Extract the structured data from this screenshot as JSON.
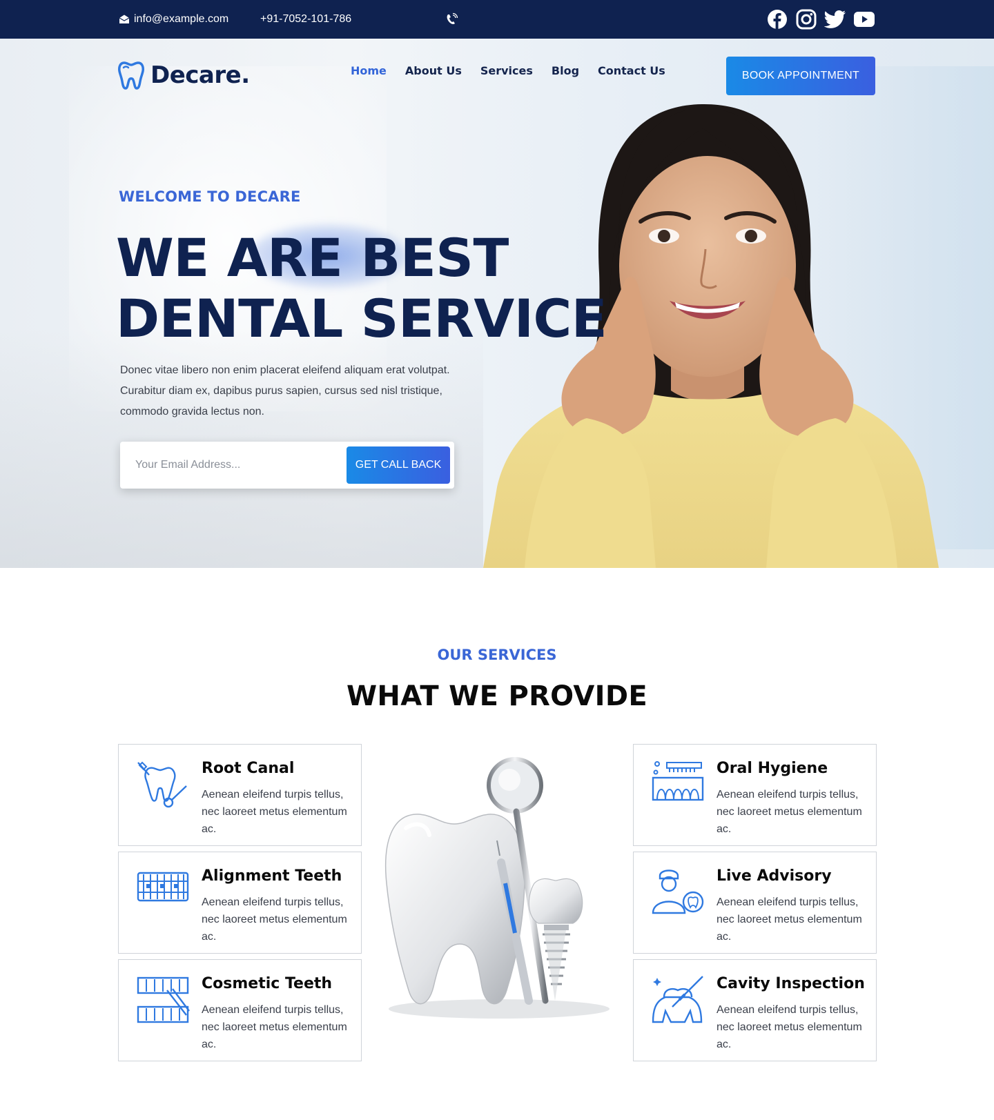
{
  "topbar": {
    "email": "info@example.com",
    "phone": "+91-7052-101-786",
    "socials": [
      "facebook-icon",
      "instagram-icon",
      "twitter-icon",
      "youtube-icon"
    ]
  },
  "nav": {
    "logo": "Decare.",
    "items": [
      "Home",
      "About Us",
      "Services",
      "Blog",
      "Contact Us"
    ],
    "active": "Home",
    "cta": "BOOK APPOINTMENT"
  },
  "hero": {
    "kicker": "WELCOME TO DECARE",
    "title_line1": "WE ARE BEST",
    "title_line2": "DENTAL SERVICE",
    "description": "Donec vitae libero non enim placerat eleifend aliquam erat volutpat. Curabitur diam ex, dapibus purus sapien, cursus sed nisl tristique, commodo gravida lectus non.",
    "email_placeholder": "Your Email Address...",
    "callback_button": "GET CALL BACK"
  },
  "services": {
    "kicker": "OUR SERVICES",
    "title": "WHAT WE PROVIDE",
    "items": [
      {
        "title": "Root Canal",
        "desc": "Aenean eleifend turpis tellus, nec laoreet metus elementum ac.",
        "icon": "root-canal-icon"
      },
      {
        "title": "Alignment Teeth",
        "desc": "Aenean eleifend turpis tellus, nec laoreet metus elementum ac.",
        "icon": "braces-icon"
      },
      {
        "title": "Cosmetic Teeth",
        "desc": "Aenean eleifend turpis tellus, nec laoreet metus elementum ac.",
        "icon": "cosmetic-teeth-icon"
      },
      {
        "title": "Oral Hygiene",
        "desc": "Aenean eleifend turpis tellus, nec laoreet metus elementum ac.",
        "icon": "toothbrush-icon"
      },
      {
        "title": "Live Advisory",
        "desc": "Aenean eleifend turpis tellus, nec laoreet metus elementum ac.",
        "icon": "dentist-icon"
      },
      {
        "title": "Cavity Inspection",
        "desc": "Aenean eleifend turpis tellus, nec laoreet metus elementum ac.",
        "icon": "cavity-inspection-icon"
      }
    ]
  },
  "colors": {
    "navy": "#0f2250",
    "accent": "#3a66d6",
    "button_start": "#1a8ae6",
    "button_end": "#3a5fe0"
  }
}
